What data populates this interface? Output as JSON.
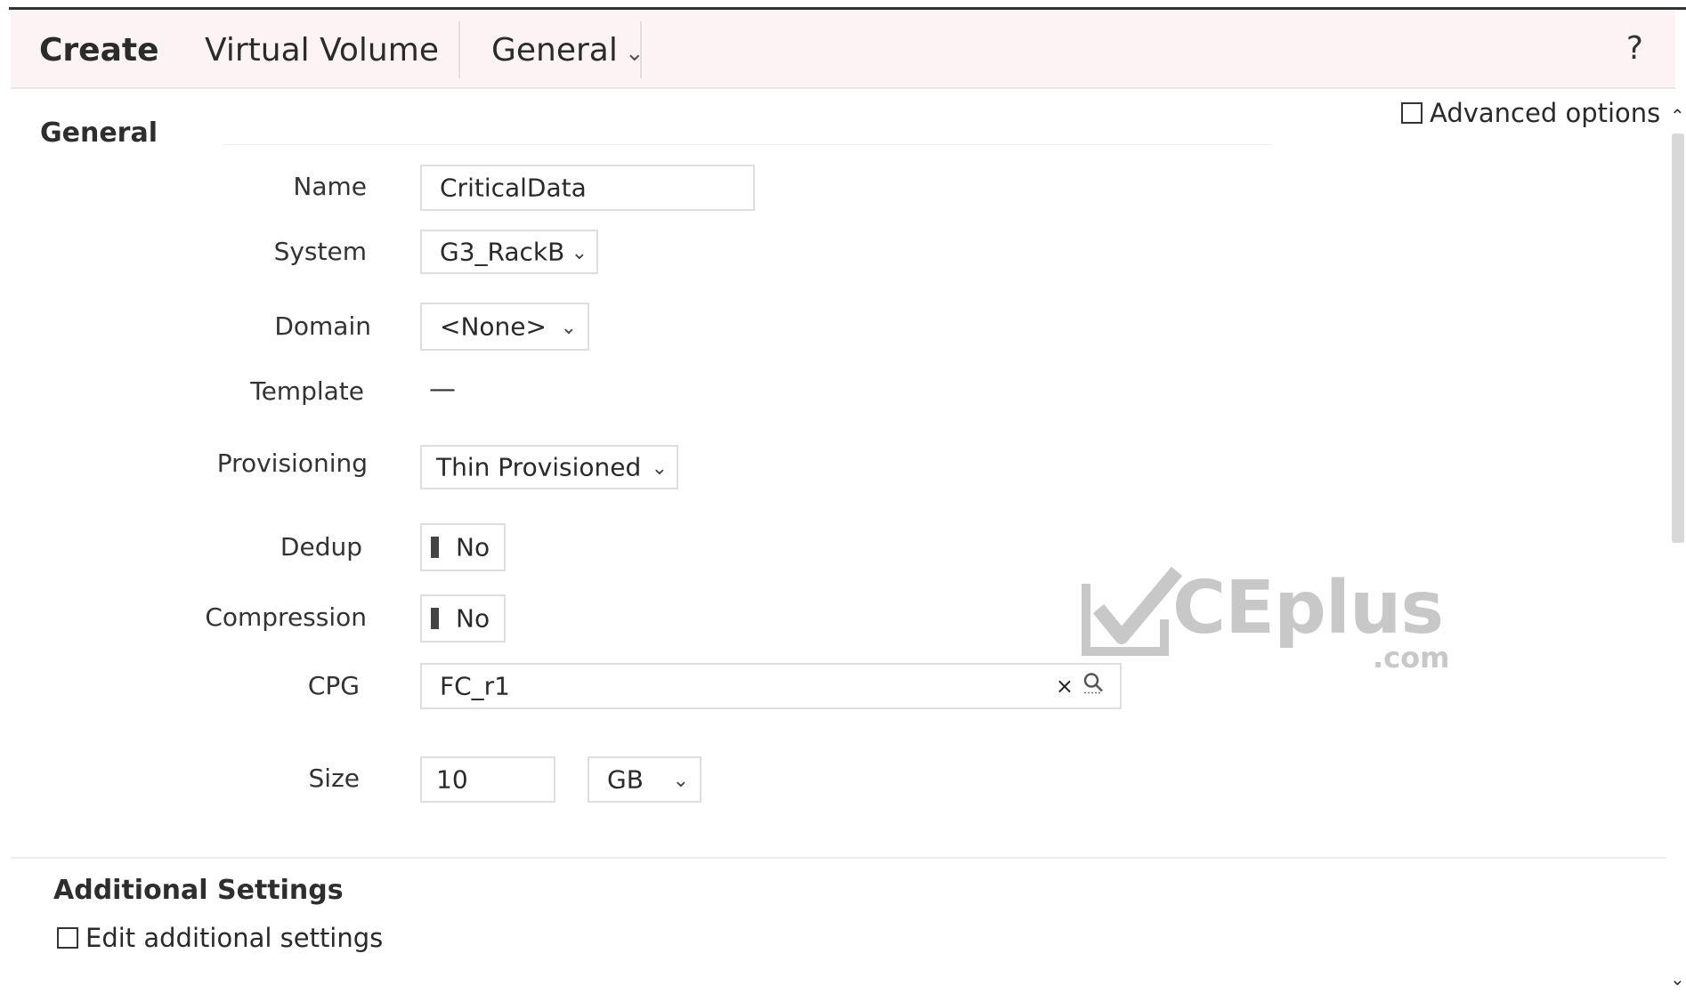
{
  "header": {
    "create": "Create",
    "object": "Virtual Volume",
    "section_menu": "General",
    "help": "?"
  },
  "advanced_options": "Advanced options",
  "general": {
    "title": "General",
    "name": {
      "label": "Name",
      "value": "CriticalData"
    },
    "system": {
      "label": "System",
      "value": "G3_RackB"
    },
    "domain": {
      "label": "Domain",
      "value": "<None>"
    },
    "template": {
      "label": "Template",
      "value": "—"
    },
    "provisioning": {
      "label": "Provisioning",
      "value": "Thin Provisioned"
    },
    "dedup": {
      "label": "Dedup",
      "value": "No"
    },
    "compression": {
      "label": "Compression",
      "value": "No"
    },
    "cpg": {
      "label": "CPG",
      "value": "FC_r1",
      "clear": "×"
    },
    "size": {
      "label": "Size",
      "value": "10",
      "unit": "GB"
    }
  },
  "additional": {
    "title": "Additional Settings",
    "edit_label": "Edit additional settings"
  },
  "watermark": {
    "text": "CEplus",
    "suffix": ".com"
  }
}
